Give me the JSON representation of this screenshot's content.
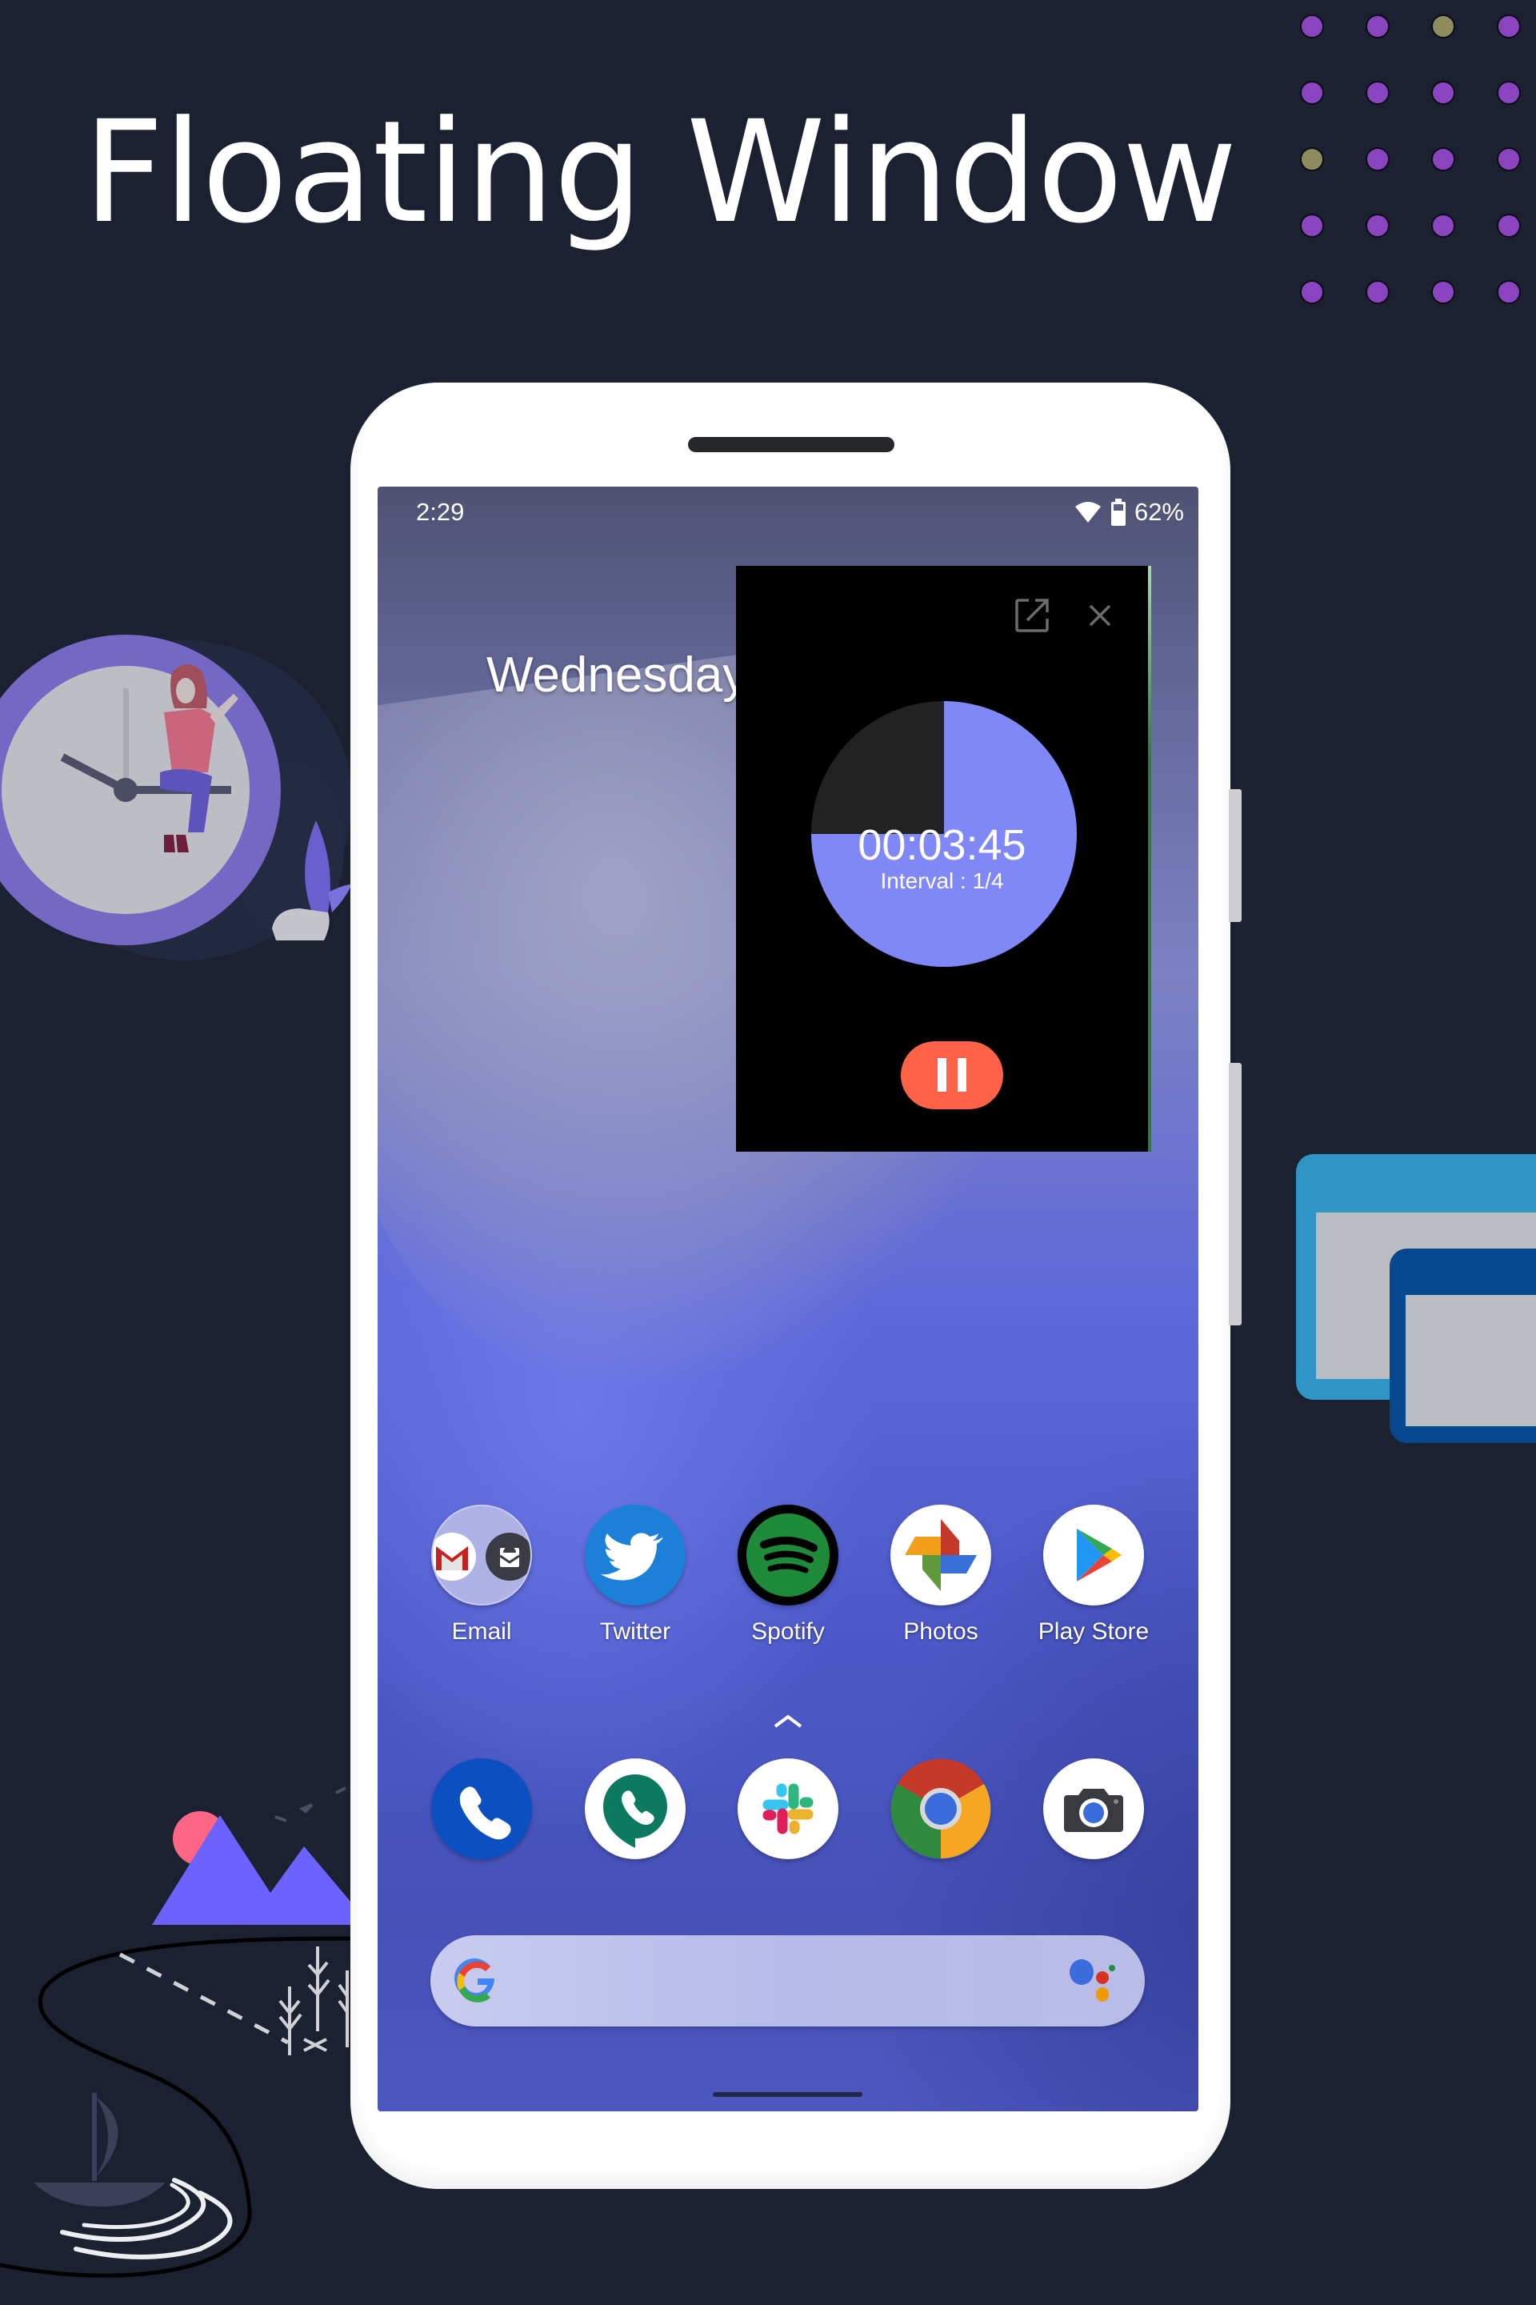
{
  "title": "Floating Window",
  "decor": {
    "dot_rows": [
      [
        "purple",
        "purple",
        "olive",
        "purple"
      ],
      [
        "purple",
        "purple",
        "purple",
        "purple"
      ],
      [
        "olive",
        "purple",
        "purple",
        "purple"
      ],
      [
        "purple",
        "purple",
        "purple",
        "purple"
      ],
      [
        "purple",
        "purple",
        "purple",
        "purple"
      ]
    ],
    "colors": {
      "purple": "#8a44c0",
      "olive": "#8c8c5e",
      "background": "#1b2130",
      "clock_ring": "#7468c4",
      "clock_face": "#bcbec4",
      "mountain": "#6c63ff",
      "sun": "#ff6584",
      "window_back": "#2e95c6",
      "window_front": "#06488f",
      "window_inner": "#b9bcc1"
    }
  },
  "phone": {
    "status_bar": {
      "time": "2:29",
      "wifi_icon": "wifi-icon",
      "battery_icon": "battery-icon",
      "battery": "62%"
    },
    "date": "Wednesday",
    "floating_window": {
      "open_icon": "open-external-icon",
      "close_icon": "close-icon",
      "timer": "00:03:45",
      "interval": "Interval : 1/4",
      "remaining_fraction": 0.75,
      "pie_color": "#8088f8",
      "elapsed_color": "#222222",
      "pause_icon": "pause-icon",
      "pause_color": "#ff6347"
    },
    "apps_row": [
      {
        "label": "Email",
        "icon": "email-icon"
      },
      {
        "label": "Twitter",
        "icon": "twitter-icon"
      },
      {
        "label": "Spotify",
        "icon": "spotify-icon"
      },
      {
        "label": "Photos",
        "icon": "photos-icon"
      },
      {
        "label": "Play Store",
        "icon": "play-store-icon"
      }
    ],
    "app_drawer_icon": "chevron-up-icon",
    "dock": [
      {
        "icon": "phone-icon"
      },
      {
        "icon": "hangouts-icon"
      },
      {
        "icon": "slack-icon"
      },
      {
        "icon": "chrome-icon"
      },
      {
        "icon": "camera-icon"
      }
    ],
    "search": {
      "google_icon": "google-g-icon",
      "assistant_icon": "assistant-icon",
      "placeholder": ""
    }
  }
}
